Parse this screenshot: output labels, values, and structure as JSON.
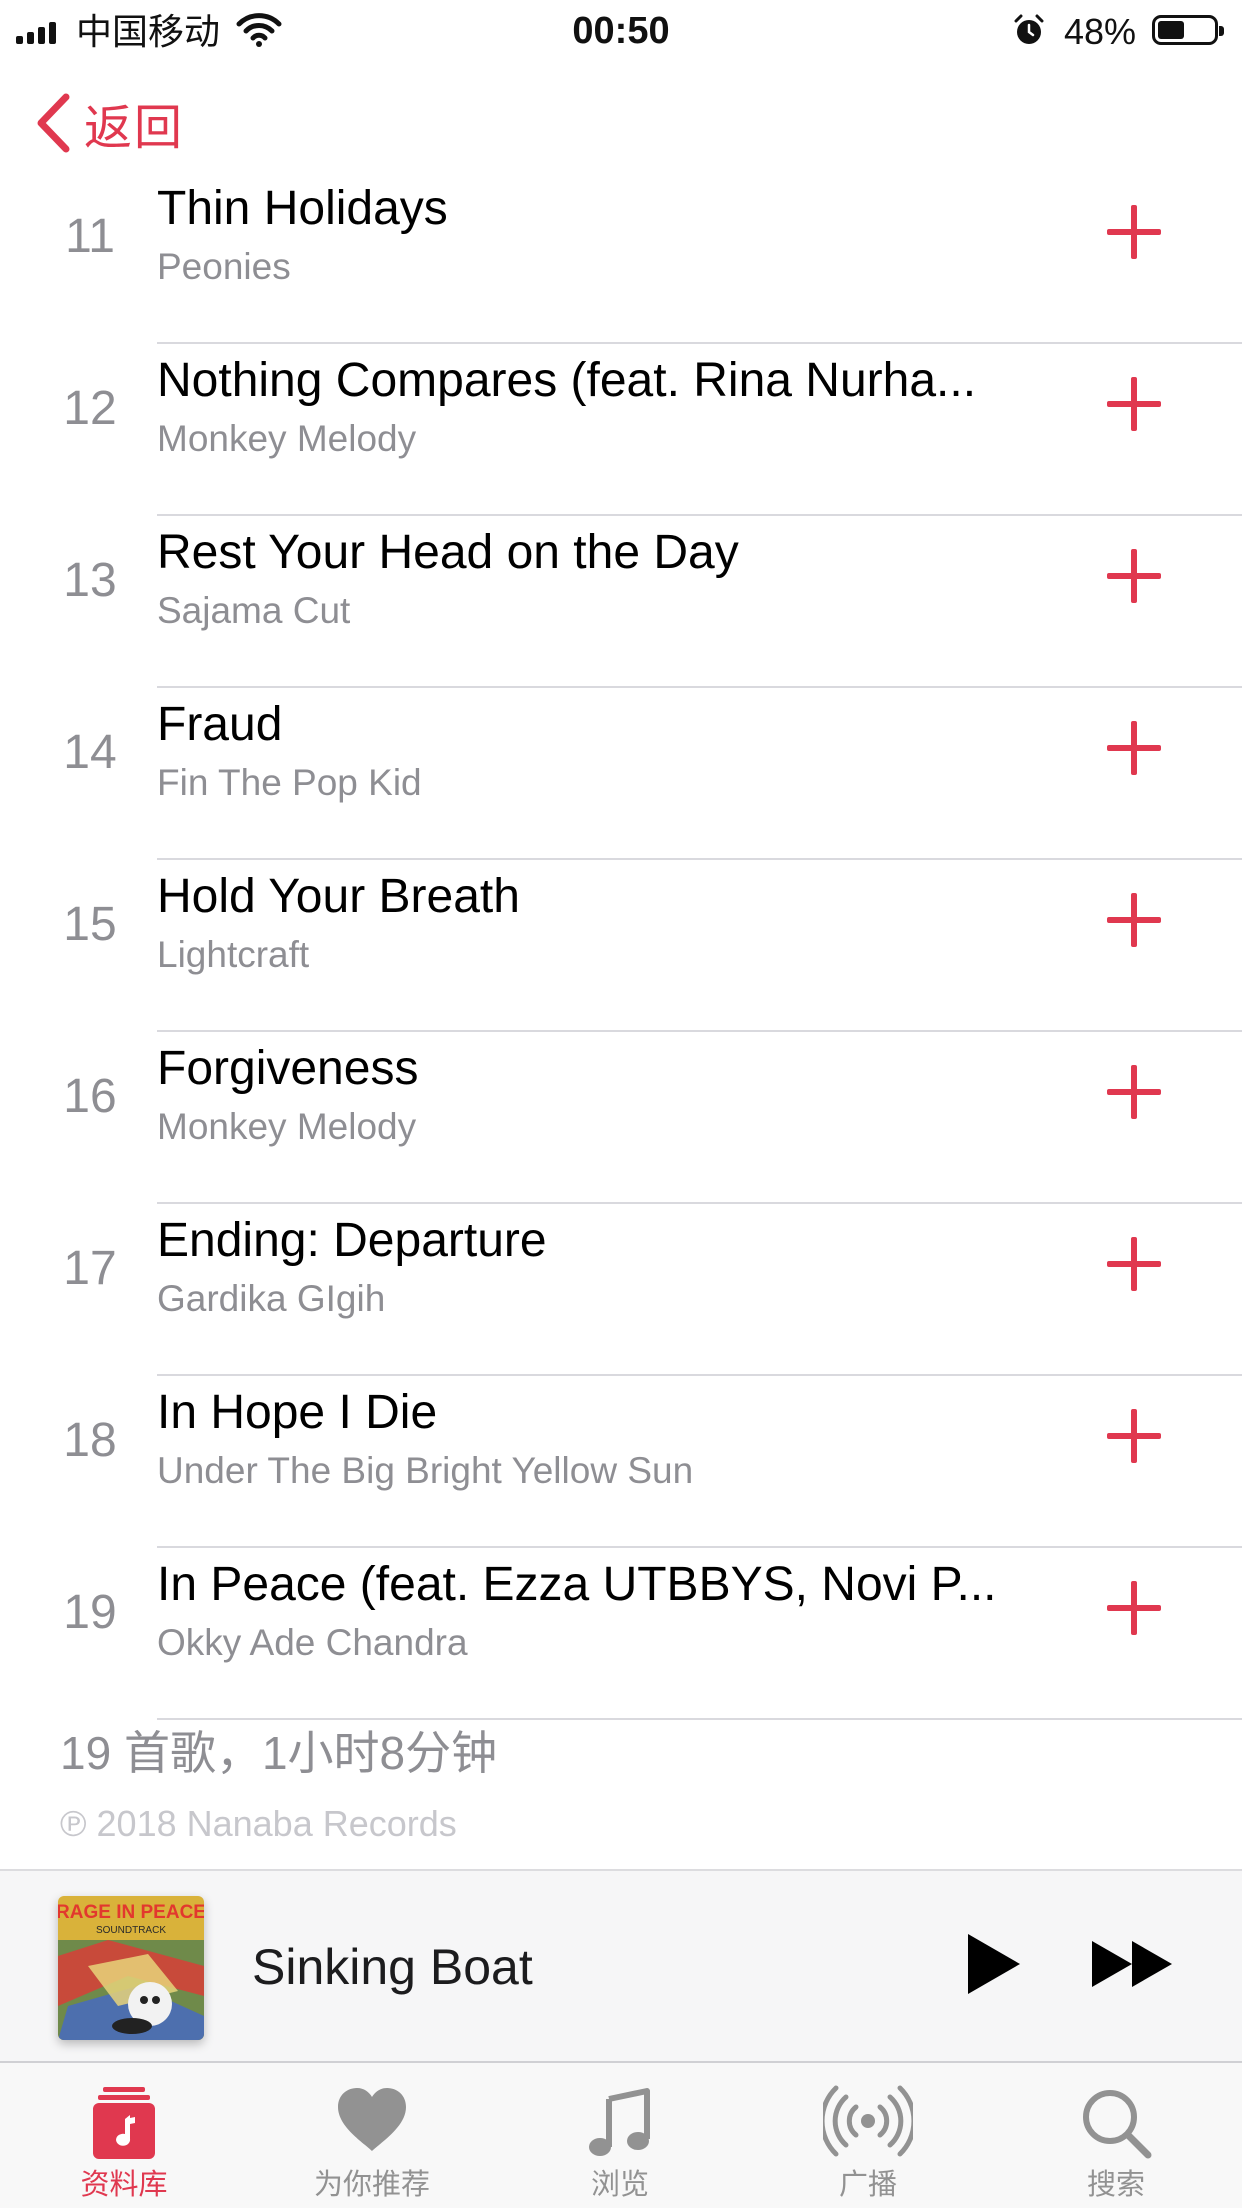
{
  "status_bar": {
    "carrier": "中国移动",
    "time": "00:50",
    "battery_percent": "48%",
    "battery_level": 0.48,
    "icons": [
      "signal-icon",
      "wifi-icon",
      "alarm-icon",
      "battery-icon"
    ]
  },
  "nav": {
    "back_label": "返回",
    "back_icon": "chevron-left-icon"
  },
  "tracks": [
    {
      "number": "11",
      "title": "Thin Holidays",
      "artist": "Peonies"
    },
    {
      "number": "12",
      "title": "Nothing Compares (feat. Rina Nurha...",
      "artist": "Monkey Melody"
    },
    {
      "number": "13",
      "title": "Rest Your Head on the Day",
      "artist": "Sajama Cut"
    },
    {
      "number": "14",
      "title": "Fraud",
      "artist": "Fin The Pop Kid"
    },
    {
      "number": "15",
      "title": "Hold Your Breath",
      "artist": "Lightcraft"
    },
    {
      "number": "16",
      "title": "Forgiveness",
      "artist": "Monkey Melody"
    },
    {
      "number": "17",
      "title": "Ending: Departure",
      "artist": "Gardika GIgih"
    },
    {
      "number": "18",
      "title": "In Hope I Die",
      "artist": "Under The Big Bright Yellow Sun"
    },
    {
      "number": "19",
      "title": "In Peace (feat. Ezza UTBBYS, Novi P...",
      "artist": "Okky Ade Chandra"
    }
  ],
  "album_summary": "19 首歌，1小时8分钟",
  "copyright": "℗ 2018 Nanaba Records",
  "mini_player": {
    "title": "Sinking Boat",
    "artwork_text_line1": "RAGE IN PEACE",
    "artwork_text_line2": "SOUNDTRACK",
    "play_icon": "play-icon",
    "forward_icon": "fast-forward-icon"
  },
  "tab_bar": {
    "tabs": [
      {
        "label": "资料库",
        "icon": "library-icon",
        "active": true
      },
      {
        "label": "为你推荐",
        "icon": "heart-icon",
        "active": false
      },
      {
        "label": "浏览",
        "icon": "music-note-icon",
        "active": false
      },
      {
        "label": "广播",
        "icon": "radio-icon",
        "active": false
      },
      {
        "label": "搜索",
        "icon": "search-icon",
        "active": false
      }
    ]
  },
  "colors": {
    "accent": "#e0384f",
    "secondary_text": "#8e8e93",
    "divider": "#d9d9de"
  }
}
